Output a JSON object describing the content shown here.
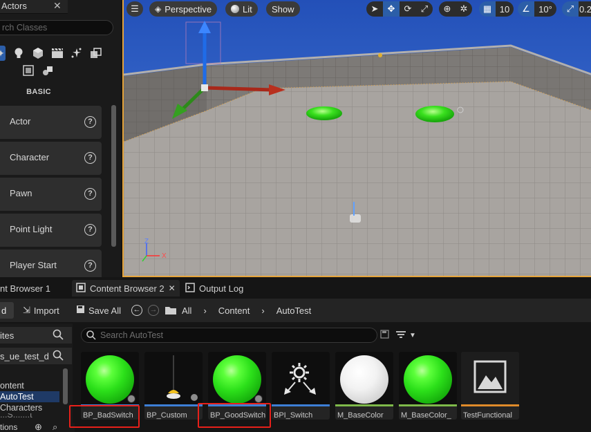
{
  "place_actors": {
    "tab_title": "Actors",
    "search_placeholder": "rch Classes",
    "category_label": "BASIC",
    "items": [
      {
        "name": "Actor"
      },
      {
        "name": "Character"
      },
      {
        "name": "Pawn"
      },
      {
        "name": "Point Light"
      },
      {
        "name": "Player Start"
      }
    ]
  },
  "viewport": {
    "perspective_label": "Perspective",
    "lit_label": "Lit",
    "show_label": "Show",
    "grid_snap_value": "10",
    "rotation_snap_value": "10°",
    "scale_snap_value": "0.2"
  },
  "bottom_tabs": {
    "content_browser_1": "nt Browser 1",
    "content_browser_2": "Content Browser 2",
    "output_log": "Output Log"
  },
  "toolbar": {
    "add_label": "d",
    "import_label": "Import",
    "save_all_label": "Save All",
    "breadcrumb": [
      "All",
      "Content",
      "AutoTest"
    ]
  },
  "sources": {
    "favorites_label": "ites",
    "project_label": "s_ue_test_d",
    "tree": [
      "ontent",
      "AutoTest",
      "Characters",
      "...S.......t"
    ],
    "footer_label": "tions"
  },
  "assets": {
    "search_placeholder": "Search AutoTest",
    "items": [
      {
        "label": "BP_BadSwitch",
        "strip_color": "#3d7fd6",
        "highlighted": true
      },
      {
        "label": "BP_Custom",
        "strip_color": "#3d7fd6",
        "highlighted": false
      },
      {
        "label": "BP_GoodSwitch",
        "strip_color": "#3d7fd6",
        "highlighted": true
      },
      {
        "label": "BPI_Switch",
        "strip_color": "#3d7fd6",
        "highlighted": false
      },
      {
        "label": "M_BaseColor",
        "strip_color": "#7fba4a",
        "highlighted": false
      },
      {
        "label": "M_BaseColor_",
        "strip_color": "#7fba4a",
        "highlighted": false
      },
      {
        "label": "TestFunctional",
        "strip_color": "#e08b2a",
        "highlighted": false
      }
    ]
  },
  "colors": {
    "accent_blue": "#2c5ea8",
    "selection_orange": "#e6a43a",
    "highlight_red": "#e8201a"
  }
}
